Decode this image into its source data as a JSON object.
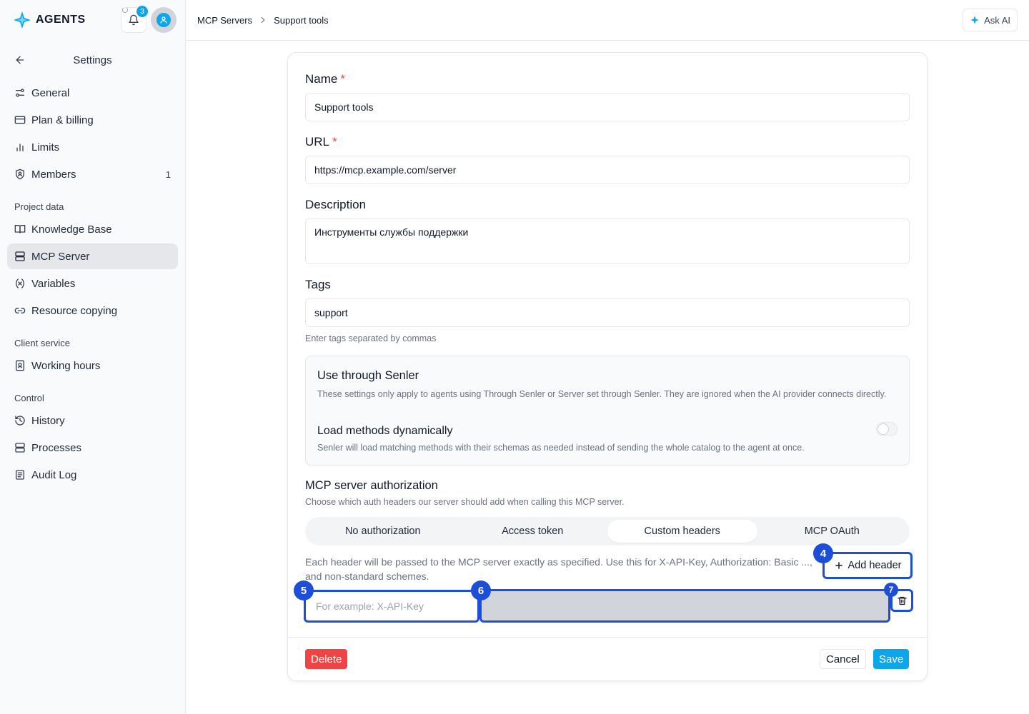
{
  "brand": {
    "name": "AGENTS",
    "notification_count": "3",
    "accent": "#0ea5e9"
  },
  "header": {
    "breadcrumb": [
      "MCP Servers",
      "Support tools"
    ],
    "ask_ai": "Ask AI"
  },
  "sidebar": {
    "title": "Settings",
    "items": [
      {
        "label": "General",
        "icon": "sliders-icon"
      },
      {
        "label": "Plan & billing",
        "icon": "credit-card-icon"
      },
      {
        "label": "Limits",
        "icon": "bar-chart-icon"
      },
      {
        "label": "Members",
        "icon": "shield-user-icon",
        "count": "1"
      }
    ],
    "sections": [
      {
        "title": "Project data",
        "items": [
          {
            "label": "Knowledge Base",
            "icon": "book-icon"
          },
          {
            "label": "MCP Server",
            "icon": "server-icon",
            "active": true
          },
          {
            "label": "Variables",
            "icon": "variable-icon"
          },
          {
            "label": "Resource copying",
            "icon": "link-icon"
          }
        ]
      },
      {
        "title": "Client service",
        "items": [
          {
            "label": "Working hours",
            "icon": "contact-icon"
          }
        ]
      },
      {
        "title": "Control",
        "items": [
          {
            "label": "History",
            "icon": "history-icon"
          },
          {
            "label": "Processes",
            "icon": "server-icon"
          },
          {
            "label": "Audit Log",
            "icon": "log-icon"
          }
        ]
      }
    ]
  },
  "form": {
    "name": {
      "label": "Name",
      "value": "Support tools"
    },
    "url": {
      "label": "URL",
      "value": "https://mcp.example.com/server"
    },
    "description": {
      "label": "Description",
      "value": "Инструменты службы поддержки"
    },
    "tags": {
      "label": "Tags",
      "value": "support",
      "hint": "Enter tags separated by commas"
    },
    "required_mark": "*",
    "senler": {
      "title": "Use through Senler",
      "desc": "These settings only apply to agents using Through Senler or Server set through Senler. They are ignored when the AI provider connects directly.",
      "dynamic_title": "Load methods dynamically",
      "dynamic_desc": "Senler will load matching methods with their schemas as needed instead of sending the whole catalog to the agent at once.",
      "dynamic_enabled": false
    },
    "auth": {
      "title": "MCP server authorization",
      "desc": "Choose which auth headers our server should add when calling this MCP server.",
      "tabs": [
        "No authorization",
        "Access token",
        "Custom headers",
        "MCP OAuth"
      ],
      "active_tab": "Custom headers",
      "headers_desc": "Each header will be passed to the MCP server exactly as specified. Use this for X-API-Key, Authorization: Basic ..., and non-standard schemes.",
      "add_header": "Add header",
      "header_name_placeholder": "For example: X-API-Key",
      "header_value": ""
    },
    "marks": [
      "4",
      "5",
      "6",
      "7"
    ]
  },
  "footer": {
    "delete": "Delete",
    "cancel": "Cancel",
    "save": "Save"
  }
}
